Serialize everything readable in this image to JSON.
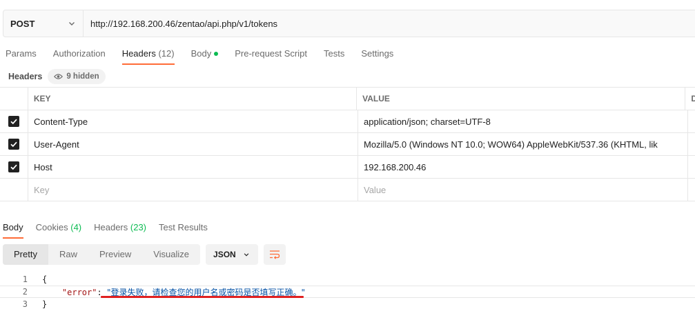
{
  "request": {
    "method": "POST",
    "url": "http://192.168.200.46/zentao/api.php/v1/tokens"
  },
  "request_tabs": [
    {
      "label": "Params",
      "active": false
    },
    {
      "label": "Authorization",
      "active": false
    },
    {
      "label": "Headers",
      "count": "(12)",
      "active": true
    },
    {
      "label": "Body",
      "active": false,
      "dot": true
    },
    {
      "label": "Pre-request Script",
      "active": false
    },
    {
      "label": "Tests",
      "active": false
    },
    {
      "label": "Settings",
      "active": false
    }
  ],
  "headers_section": {
    "label": "Headers",
    "hidden_label": "9 hidden"
  },
  "table": {
    "columns": {
      "key": "KEY",
      "value": "VALUE",
      "desc": "D"
    },
    "rows": [
      {
        "checked": true,
        "key": "Content-Type",
        "value": "application/json; charset=UTF-8"
      },
      {
        "checked": true,
        "key": "User-Agent",
        "value": "Mozilla/5.0 (Windows NT 10.0; WOW64) AppleWebKit/537.36 (KHTML, lik"
      },
      {
        "checked": true,
        "key": "Host",
        "value": "192.168.200.46"
      }
    ],
    "placeholder": {
      "key": "Key",
      "value": "Value"
    }
  },
  "response_tabs": [
    {
      "label": "Body",
      "active": true
    },
    {
      "label": "Cookies",
      "count": "(4)"
    },
    {
      "label": "Headers",
      "count": "(23)"
    },
    {
      "label": "Test Results"
    }
  ],
  "view_modes": [
    "Pretty",
    "Raw",
    "Preview",
    "Visualize"
  ],
  "active_view": "Pretty",
  "format": "JSON",
  "code_lines": [
    {
      "num": "1",
      "text": "{"
    },
    {
      "num": "2",
      "key": "\"error\"",
      "sep": ": ",
      "value": "\"登录失败，请检查您的用户名或密码是否填写正确。\""
    },
    {
      "num": "3",
      "text": "}"
    }
  ],
  "colors": {
    "accent": "#ff6c37",
    "green": "#0cbb52",
    "annotation": "#e02020"
  },
  "icons": [
    "chevron-down-icon",
    "eye-icon",
    "check-icon",
    "wrap-lines-icon"
  ]
}
